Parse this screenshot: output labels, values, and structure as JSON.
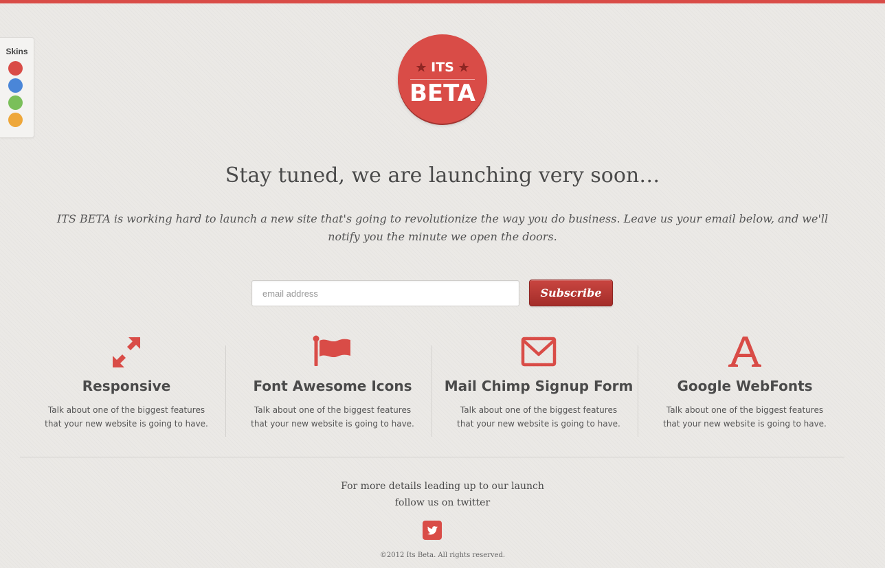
{
  "colors": {
    "accent": "#d94c47",
    "accent_dark": "#a42d29",
    "background": "#ebe9e6",
    "text": "#4a4a4a"
  },
  "skins": {
    "label": "Skins",
    "options": [
      {
        "name": "red",
        "color": "#d94c47"
      },
      {
        "name": "blue",
        "color": "#4a86d8"
      },
      {
        "name": "green",
        "color": "#7abf5a"
      },
      {
        "name": "orange",
        "color": "#eea73a"
      }
    ]
  },
  "logo": {
    "top_text": "ITS",
    "main_text": "BETA",
    "icon": "star-icon"
  },
  "headline": "Stay tuned, we are launching very soon…",
  "intro": "ITS BETA is working hard to launch a new site that's going to revolutionize the way you do business. Leave us your email below, and we'll notify you the minute we open the doors.",
  "signup": {
    "placeholder": "email address",
    "button_label": "Subscribe"
  },
  "features": [
    {
      "icon": "resize-arrows-icon",
      "title": "Responsive",
      "text": "Talk about one of the biggest features that your new website is going to have."
    },
    {
      "icon": "flag-icon",
      "title": "Font Awesome Icons",
      "text": "Talk about one of the biggest features that your new website is going to have."
    },
    {
      "icon": "envelope-icon",
      "title": "Mail Chimp Signup Form",
      "text": "Talk about one of the biggest features that your new website is going to have."
    },
    {
      "icon": "font-letter-icon",
      "title": "Google WebFonts",
      "text": "Talk about one of the biggest features that your new website is going to have."
    }
  ],
  "footer": {
    "line1": "For more details leading up to our launch",
    "line2": "follow us on twitter",
    "social_icon": "twitter-icon",
    "copyright": "©2012 Its Beta. All rights reserved."
  }
}
